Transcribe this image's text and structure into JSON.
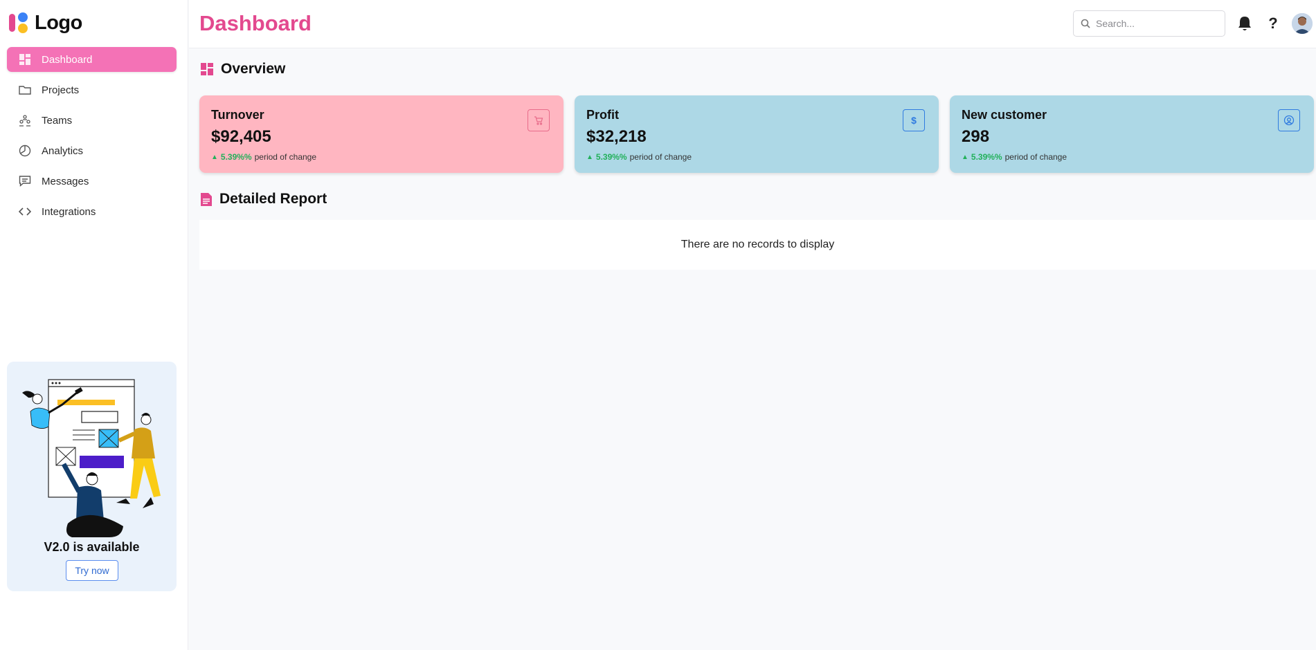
{
  "sidebar": {
    "logo_text": "Logo",
    "items": [
      {
        "label": "Dashboard",
        "icon": "dashboard-icon",
        "active": true
      },
      {
        "label": "Projects",
        "icon": "folder-icon"
      },
      {
        "label": "Teams",
        "icon": "teams-icon"
      },
      {
        "label": "Analytics",
        "icon": "pie-chart-icon"
      },
      {
        "label": "Messages",
        "icon": "message-icon"
      },
      {
        "label": "Integrations",
        "icon": "code-icon"
      }
    ],
    "promo": {
      "title": "V2.0 is available",
      "button": "Try now"
    }
  },
  "header": {
    "title": "Dashboard",
    "search_placeholder": "Search...",
    "icons": [
      "bell-icon",
      "help-icon",
      "avatar"
    ]
  },
  "overview": {
    "heading": "Overview",
    "cards": [
      {
        "title": "Turnover",
        "value": "$92,405",
        "change": "5.39%%",
        "change_text": "period of change",
        "icon": "cart-icon"
      },
      {
        "title": "Profit",
        "value": "$32,218",
        "change": "5.39%%",
        "change_text": "period of change",
        "icon": "dollar-icon"
      },
      {
        "title": "New customer",
        "value": "298",
        "change": "5.39%%",
        "change_text": "period of change",
        "icon": "user-circle-icon"
      }
    ]
  },
  "report": {
    "heading": "Detailed Report",
    "empty_text": "There are no records to display"
  },
  "colors": {
    "accent": "#e3498f",
    "active_nav": "#f472b6",
    "card_pink": "#ffb6c1",
    "card_blue": "#add8e6",
    "positive": "#22b05a"
  }
}
